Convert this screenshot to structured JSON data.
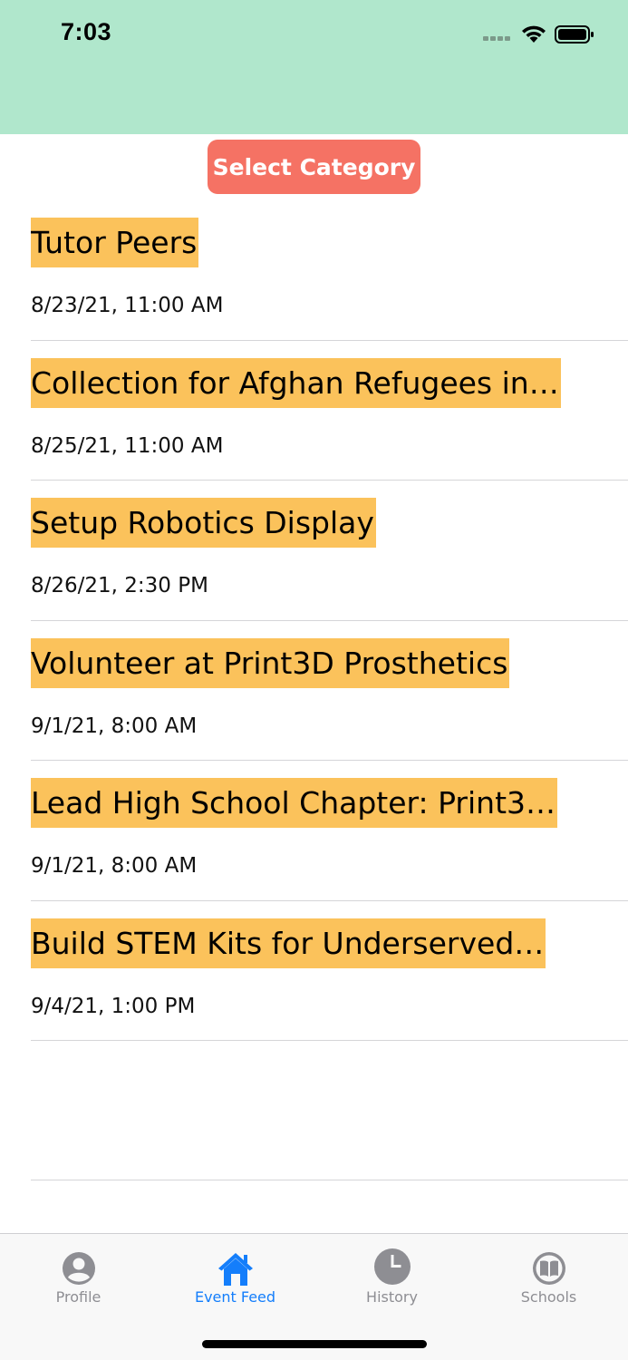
{
  "status_bar": {
    "time": "7:03"
  },
  "colors": {
    "header_bg": "#b0e7cc",
    "button_bg": "#f57264",
    "title_highlight": "#fbc25b",
    "tab_active": "#147efb",
    "tab_inactive": "#8e8e93"
  },
  "select_category": {
    "label": "Select Category"
  },
  "events": [
    {
      "title": "Tutor Peers",
      "date": "8/23/21, 11:00 AM"
    },
    {
      "title": "Collection for Afghan Refugees in…",
      "date": "8/25/21, 11:00 AM"
    },
    {
      "title": "Setup Robotics Display",
      "date": "8/26/21, 2:30 PM"
    },
    {
      "title": "Volunteer at Print3D Prosthetics",
      "date": "9/1/21, 8:00 AM"
    },
    {
      "title": "Lead High School Chapter: Print3…",
      "date": "9/1/21, 8:00 AM"
    },
    {
      "title": "Build STEM Kits for Underserved…",
      "date": "9/4/21, 1:00 PM"
    }
  ],
  "tab_bar": {
    "tabs": [
      {
        "label": "Profile",
        "icon": "person-circle-icon",
        "active": false
      },
      {
        "label": "Event Feed",
        "icon": "house-icon",
        "active": true
      },
      {
        "label": "History",
        "icon": "clock-icon",
        "active": false
      },
      {
        "label": "Schools",
        "icon": "book-circle-icon",
        "active": false
      }
    ]
  }
}
